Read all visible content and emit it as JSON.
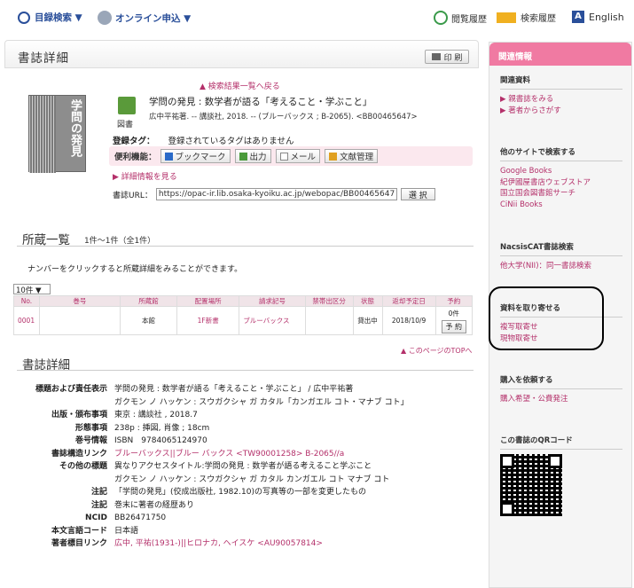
{
  "topbar": {
    "catalog_search": "目録検索 ▼",
    "online_apply": "オンライン申込 ▼",
    "browse_history": "閲覧履歴",
    "search_history": "検索履歴",
    "language": "English"
  },
  "main": {
    "title": "書誌詳細",
    "print": "印 刷",
    "back_link": "▲ 検索結果一覧へ戻る",
    "cover_title": "学問の発見",
    "doc_type": "図書",
    "book_title": "学問の発見 : 数学者が語る「考えること・学ぶこと」",
    "book_sub": "広中平祐著. -- 講談社, 2018. -- (ブルーバックス ; B-2065). <BB00465647>",
    "tag_label": "登録タグ：",
    "tag_value": "登録されているタグはありません",
    "convenience_label": "便利機能：",
    "btn_bookmark": "ブックマーク",
    "btn_output": "出力",
    "btn_mail": "メール",
    "btn_reference": "文献管理",
    "detail_more": "▶ 詳細情報を見る",
    "url_label": "書誌URL：",
    "url_value": "https://opac-ir.lib.osaka-kyoiku.ac.jp/webopac/BB00465647",
    "select": "選 択"
  },
  "holdings": {
    "title": "所蔵一覧",
    "count": "1件～1件（全1件）",
    "note": "ナンバーをクリックすると所蔵詳細をみることができます。",
    "per_page": "10件 ▼",
    "headers": [
      "No.",
      "巻号",
      "所蔵館",
      "配置場所",
      "請求記号",
      "禁帯出区分",
      "状態",
      "返却予定日",
      "予約"
    ],
    "row": {
      "no": "0001",
      "volume": "",
      "library": "本館",
      "location": "1F新書",
      "call_no": "ブルーバックス",
      "restriction": "",
      "status": "貸出中",
      "due": "2018/10/9",
      "reserve_count": "0件",
      "reserve_btn": "予 約"
    },
    "to_top": "▲ このページのTOPへ"
  },
  "detail": {
    "title": "書誌詳細",
    "rows": [
      {
        "k": "標題および責任表示",
        "v": "学問の発見 : 数学者が語る「考えること・学ぶこと」 / 広中平祐著"
      },
      {
        "k": "",
        "v": "ガクモン ノ ハッケン : スウガクシャ ガ カタル「カンガエル コト・マナブ コト」"
      },
      {
        "k": "出版・頒布事項",
        "v": "東京 : 講談社 , 2018.7"
      },
      {
        "k": "形態事項",
        "v": "238p : 挿図, 肖像 ; 18cm"
      },
      {
        "k": "巻号情報",
        "v": "ISBN　9784065124970"
      },
      {
        "k": "書誌構造リンク",
        "v": "ブルーバックス||ブルー バックス <TW90001258> B-2065//a"
      },
      {
        "k": "その他の標題",
        "v": "異なりアクセスタイトル:学問の発見 : 数学者が語る考えること学ぶこと"
      },
      {
        "k": "",
        "v": "ガクモン ノ ハッケン : スウガクシャ ガ カタル カンガエル コト マナブ コト"
      },
      {
        "k": "注記",
        "v": "「学問の発見」(佼成出版社, 1982.10)の写真等の一部を変更したもの"
      },
      {
        "k": "注記",
        "v": "巻末に著者の経歴あり"
      },
      {
        "k": "NCID",
        "v": "BB26471750"
      },
      {
        "k": "本文言語コード",
        "v": "日本語"
      },
      {
        "k": "著者標目リンク",
        "v": "広中, 平祐(1931-)||ヒロナカ, ヘイスケ <AU90057814>"
      }
    ]
  },
  "sidebar": {
    "header": "関連情報",
    "related_title": "関連資料",
    "related_items": [
      "▶ 親書誌をみる",
      "▶ 著者からさがす"
    ],
    "other_title": "他のサイトで検索する",
    "other_items": [
      "Google Books",
      "紀伊國屋書店ウェブストア",
      "国立国会図書館サーチ",
      "CiNii Books"
    ],
    "nacsis_title": "NacsisCAT書誌検索",
    "nacsis_items": [
      "他大学(NII)：同一書誌検索"
    ],
    "order_title": "資料を取り寄せる",
    "order_items": [
      "複写取寄せ",
      "現物取寄せ"
    ],
    "purchase_title": "購入を依頼する",
    "purchase_items": [
      "購入希望・公費発注"
    ],
    "qr_title": "この書誌のQRコード"
  },
  "colors": {
    "accent": "#f07aa2",
    "link": "#b4306a",
    "title_blue": "#2a4f9a"
  }
}
